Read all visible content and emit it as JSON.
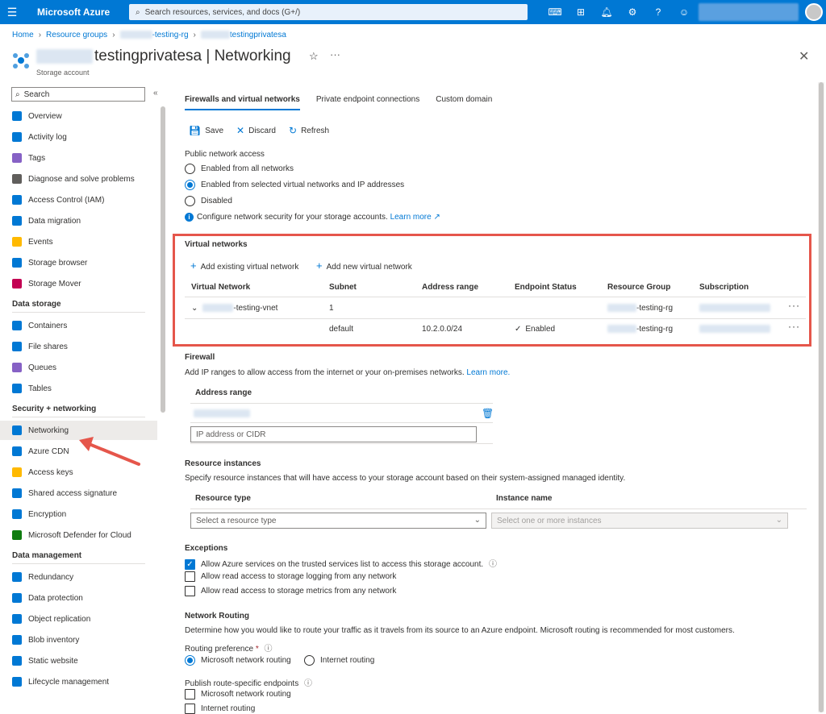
{
  "topbar": {
    "brand": "Microsoft Azure",
    "search_placeholder": "Search resources, services, and docs (G+/)"
  },
  "breadcrumb": {
    "home": "Home",
    "resource_groups": "Resource groups",
    "rg_suffix": "-testing-rg",
    "sa_suffix": "testingprivatesa"
  },
  "header": {
    "title": "testingprivatesa | Networking",
    "subtitle": "Storage account"
  },
  "sidebar": {
    "search": "Search",
    "top_items": [
      {
        "label": "Overview",
        "color": "#0078d4"
      },
      {
        "label": "Activity log",
        "color": "#0078d4"
      },
      {
        "label": "Tags",
        "color": "#8661c5"
      },
      {
        "label": "Diagnose and solve problems",
        "color": "#605e5c"
      },
      {
        "label": "Access Control (IAM)",
        "color": "#0078d4"
      },
      {
        "label": "Data migration",
        "color": "#0078d4"
      },
      {
        "label": "Events",
        "color": "#ffb900"
      },
      {
        "label": "Storage browser",
        "color": "#0078d4"
      },
      {
        "label": "Storage Mover",
        "color": "#c30052"
      }
    ],
    "section_data_storage": "Data storage",
    "data_items": [
      {
        "label": "Containers",
        "color": "#0078d4"
      },
      {
        "label": "File shares",
        "color": "#0078d4"
      },
      {
        "label": "Queues",
        "color": "#8661c5"
      },
      {
        "label": "Tables",
        "color": "#0078d4"
      }
    ],
    "section_security": "Security + networking",
    "security_items": [
      {
        "label": "Networking",
        "color": "#0078d4"
      },
      {
        "label": "Azure CDN",
        "color": "#0078d4"
      },
      {
        "label": "Access keys",
        "color": "#ffb900"
      },
      {
        "label": "Shared access signature",
        "color": "#0078d4"
      },
      {
        "label": "Encryption",
        "color": "#0078d4"
      },
      {
        "label": "Microsoft Defender for Cloud",
        "color": "#107c10"
      }
    ],
    "section_data_mgmt": "Data management",
    "mgmt_items": [
      {
        "label": "Redundancy",
        "color": "#0078d4"
      },
      {
        "label": "Data protection",
        "color": "#0078d4"
      },
      {
        "label": "Object replication",
        "color": "#0078d4"
      },
      {
        "label": "Blob inventory",
        "color": "#0078d4"
      },
      {
        "label": "Static website",
        "color": "#0078d4"
      },
      {
        "label": "Lifecycle management",
        "color": "#0078d4"
      }
    ]
  },
  "tabs": [
    "Firewalls and virtual networks",
    "Private endpoint connections",
    "Custom domain"
  ],
  "commands": {
    "save": "Save",
    "discard": "Discard",
    "refresh": "Refresh"
  },
  "public_access": {
    "label": "Public network access",
    "options": [
      "Enabled from all networks",
      "Enabled from selected virtual networks and IP addresses",
      "Disabled"
    ],
    "selected": 1,
    "info_text": "Configure network security for your storage accounts.",
    "learn_more": "Learn more"
  },
  "vnets": {
    "title": "Virtual networks",
    "add_existing": "Add existing virtual network",
    "add_new": "Add new virtual network",
    "columns": [
      "Virtual Network",
      "Subnet",
      "Address range",
      "Endpoint Status",
      "Resource Group",
      "Subscription"
    ],
    "row1": {
      "vnet": "-testing-vnet",
      "subnet": "1",
      "rg": "-testing-rg"
    },
    "row2": {
      "subnet": "default",
      "range": "10.2.0.0/24",
      "status": "Enabled",
      "rg": "-testing-rg"
    }
  },
  "firewall": {
    "title": "Firewall",
    "desc": "Add IP ranges to allow access from the internet or your on-premises networks.",
    "learn_more": "Learn more.",
    "column": "Address range",
    "placeholder": "IP address or CIDR"
  },
  "resource_instances": {
    "title": "Resource instances",
    "desc": "Specify resource instances that will have access to your storage account based on their system-assigned managed identity.",
    "col_type": "Resource type",
    "col_instance": "Instance name",
    "type_placeholder": "Select a resource type",
    "instance_placeholder": "Select one or more instances"
  },
  "exceptions": {
    "title": "Exceptions",
    "items": [
      {
        "label": "Allow Azure services on the trusted services list to access this storage account.",
        "checked": true
      },
      {
        "label": "Allow read access to storage logging from any network",
        "checked": false
      },
      {
        "label": "Allow read access to storage metrics from any network",
        "checked": false
      }
    ]
  },
  "routing": {
    "title": "Network Routing",
    "desc": "Determine how you would like to route your traffic as it travels from its source to an Azure endpoint. Microsoft routing is recommended for most customers.",
    "pref_label": "Routing preference",
    "required": "*",
    "opt_ms": "Microsoft network routing",
    "opt_inet": "Internet routing",
    "publish_label": "Publish route-specific endpoints",
    "pub_ms": "Microsoft network routing",
    "pub_inet": "Internet routing"
  },
  "colors": {
    "accent": "#0078d4",
    "highlight": "#e5564b"
  }
}
